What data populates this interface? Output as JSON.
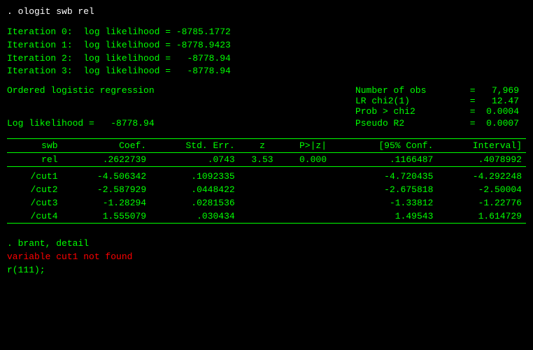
{
  "command": ". ologit swb rel",
  "iterations": [
    {
      "label": "Iteration 0:",
      "text": "log likelihood = -8785.1772"
    },
    {
      "label": "Iteration 1:",
      "text": "log likelihood = -8778.9423"
    },
    {
      "label": "Iteration 2:",
      "text": "log likelihood =   -8778.94"
    },
    {
      "label": "Iteration 3:",
      "text": "log likelihood =   -8778.94"
    }
  ],
  "regression_title": "Ordered logistic regression",
  "stats": {
    "n_obs_label": "Number of obs",
    "n_obs_value": "7,969",
    "lr_chi2_label": "LR chi2(1)",
    "lr_chi2_value": "12.47",
    "prob_label": "Prob > chi2",
    "prob_value": "0.0004",
    "pseudo_label": "Pseudo R2",
    "pseudo_value": "0.0007"
  },
  "log_likelihood_label": "Log likelihood =",
  "log_likelihood_value": "-8778.94",
  "table": {
    "headers": [
      "swb",
      "Coef.",
      "Std. Err.",
      "z",
      "P>|z|",
      "[95% Conf.",
      "Interval]"
    ],
    "rows": [
      {
        "var": "rel",
        "coef": ".2622739",
        "se": ".0743",
        "z": "3.53",
        "p": "0.000",
        "ci_lo": ".1166487",
        "ci_hi": ".4078992"
      }
    ],
    "cuts": [
      {
        "var": "/cut1",
        "coef": "-4.506342",
        "se": ".1092335",
        "z": "",
        "p": "",
        "ci_lo": "-4.720435",
        "ci_hi": "-4.292248"
      },
      {
        "var": "/cut2",
        "coef": "-2.587929",
        "se": ".0448422",
        "z": "",
        "p": "",
        "ci_lo": "-2.675818",
        "ci_hi": "-2.50004"
      },
      {
        "var": "/cut3",
        "coef": "-1.28294",
        "se": ".0281536",
        "z": "",
        "p": "",
        "ci_lo": "-1.33812",
        "ci_hi": "-1.22776"
      },
      {
        "var": "/cut4",
        "coef": "1.555079",
        "se": ".030434",
        "z": "",
        "p": "",
        "ci_lo": "1.49543",
        "ci_hi": "1.614729"
      }
    ]
  },
  "footer_commands": [
    {
      "text": ". brant, detail",
      "color": "green"
    },
    {
      "text": "variable cut1 not found",
      "color": "red"
    },
    {
      "text": "r(111);",
      "color": "green"
    }
  ]
}
